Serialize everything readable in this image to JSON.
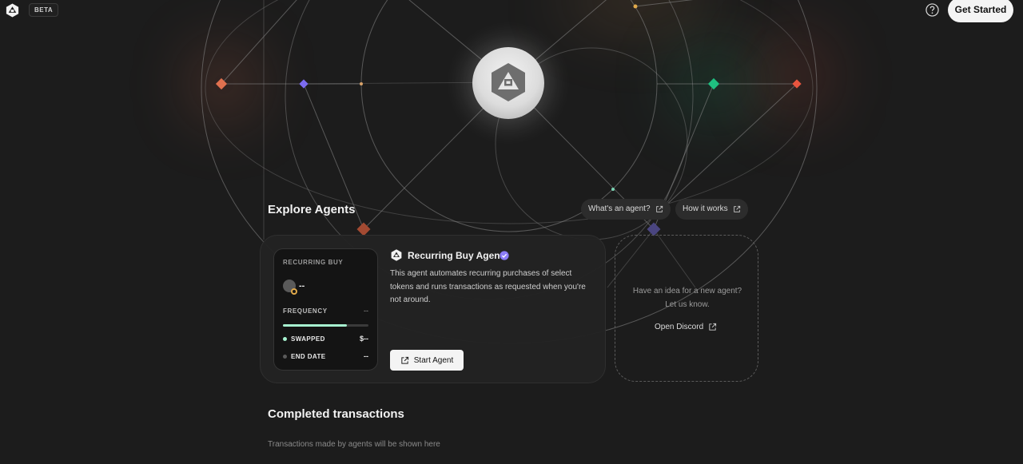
{
  "header": {
    "logo_icon": "cube-hexagon-logo-icon",
    "beta_badge": "BETA",
    "help_icon": "question-circle-icon",
    "get_started_label": "Get Started"
  },
  "hero": {
    "hub_icon": "cube-hexagon-logo-icon",
    "node_colors": [
      "#e0714f",
      "#7c6cf0",
      "#1fbf80",
      "#e8553f",
      "#e0a94a"
    ]
  },
  "explore": {
    "title": "Explore Agents",
    "whats_an_agent_label": "What's an agent?",
    "how_it_works_label": "How it works"
  },
  "agent_card": {
    "inner": {
      "type_label": "RECURRING BUY",
      "token_value": "--",
      "frequency_label": "FREQUENCY",
      "frequency_value": "--",
      "progress": 0.75,
      "swapped_label": "SWAPPED",
      "swapped_value": "$--",
      "end_date_label": "END DATE",
      "end_date_value": "--",
      "swapped_dot_color": "#a7f3d0",
      "end_date_dot_color": "#5a5a5a"
    },
    "name": "Recurring Buy Agent",
    "verified_icon": "verified-badge-icon",
    "description": "This agent automates recurring purchases of select tokens and runs transactions as requested when you're not around.",
    "start_label": "Start Agent"
  },
  "idea_card": {
    "line1": "Have an idea for a new agent?",
    "line2": "Let us know.",
    "discord_label": "Open Discord"
  },
  "transactions": {
    "title": "Completed transactions",
    "empty_text": "Transactions made by agents will be shown here"
  }
}
